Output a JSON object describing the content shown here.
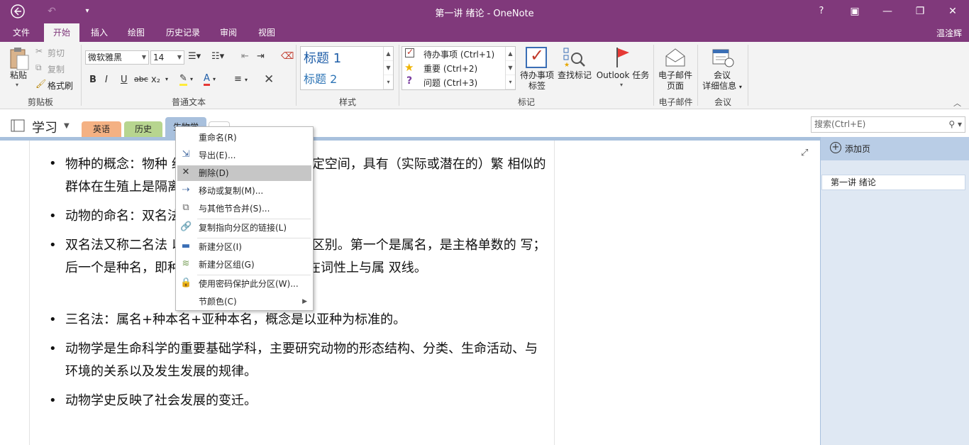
{
  "window": {
    "title": "第一讲  绪论 - OneNote",
    "help": "?",
    "user": "温淦辉"
  },
  "menu_tabs": [
    "文件",
    "开始",
    "插入",
    "绘图",
    "历史记录",
    "审阅",
    "视图"
  ],
  "ribbon": {
    "clipboard": {
      "paste": "粘贴",
      "cut": "剪切",
      "copy": "复制",
      "format_painter": "格式刷",
      "label": "剪贴板"
    },
    "text": {
      "font": "微软雅黑",
      "size": "14",
      "label": "普通文本",
      "bold": "B",
      "italic": "I",
      "underline": "U",
      "strike": "abc",
      "sub": "x₂"
    },
    "styles": {
      "h1": "标题 1",
      "h2": "标题 2",
      "label": "样式"
    },
    "tags": {
      "todo": "待办事项 (Ctrl+1)",
      "important": "重要 (Ctrl+2)",
      "question": "问题 (Ctrl+3)",
      "todo_tag_line1": "待办事项",
      "todo_tag_line2": "标签",
      "find_tags": "查找标记",
      "outlook_tasks": "Outlook 任务",
      "label": "标记"
    },
    "email": {
      "line1": "电子邮件",
      "line2": "页面",
      "label": "电子邮件"
    },
    "meeting": {
      "line1": "会议",
      "line2": "详细信息",
      "label": "会议"
    }
  },
  "notebook": {
    "name": "学习",
    "sections": [
      "英语",
      "历史",
      "生物学"
    ],
    "section_colors": [
      "#f4b183",
      "#b7d58f",
      "#9fc5e8"
    ],
    "search_placeholder": "搜索(Ctrl+E)"
  },
  "content": {
    "paragraphs": [
      "物种的概念：物种                              组成的特定群体，占有一定空间，具有（实际或潜在的）繁                              相似的群体在生殖上是隔离的。",
      "动物的命名：双名法                              名。",
      "双名法又称二名法                              以斜体字或下划双线以示区别。第一个是属名，是主格单数的                              写；后一个是种名，即种加词，常为形容词，须在词性上与属                              双线。",
      "三名法：属名+种本名+亚种本名，概念是以亚种为标准的。",
      "动物学是生命科学的重要基础学科，主要研究动物的形态结构、分类、生命活动、与环境的关系以及发生发展的规律。",
      "动物学史反映了社会发展的变迁。"
    ]
  },
  "pages": {
    "add_page": "添加页",
    "items": [
      "第一讲  绪论"
    ]
  },
  "context_menu": {
    "items": [
      {
        "label": "重命名(R)",
        "icon": "rename-icon"
      },
      {
        "label": "导出(E)...",
        "icon": "export-icon"
      },
      {
        "label": "删除(D)",
        "icon": "delete-icon"
      },
      {
        "label": "移动或复制(M)...",
        "icon": "move-copy-icon"
      },
      {
        "label": "与其他节合并(S)...",
        "icon": "merge-icon"
      },
      {
        "label": "复制指向分区的链接(L)",
        "icon": "link-icon"
      },
      {
        "label": "新建分区(I)",
        "icon": "new-section-icon"
      },
      {
        "label": "新建分区组(G)",
        "icon": "new-section-group-icon"
      },
      {
        "label": "使用密码保护此分区(W)...",
        "icon": "lock-icon"
      },
      {
        "label": "节颜色(C)",
        "icon": "none"
      }
    ]
  },
  "colors": {
    "accent": "#80397b",
    "ribbon_bg": "#f3f3f3",
    "page_pane": "#dfe8f3"
  }
}
